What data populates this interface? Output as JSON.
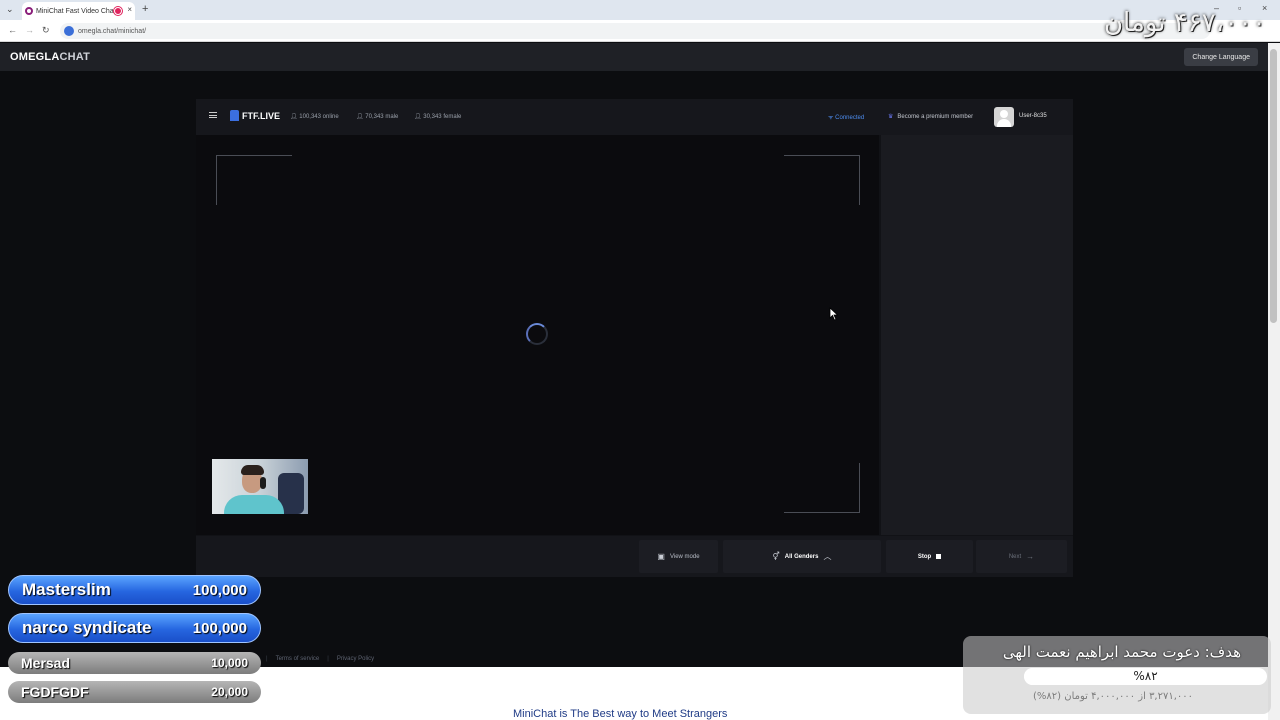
{
  "browser": {
    "tab_title": "MiniChat Fast Video Chat",
    "tab_close": "×",
    "new_tab": "+",
    "url": "omegla.chat/minichat/"
  },
  "overlay": {
    "top_amount": "۴۶۷،۰۰۰ تومان"
  },
  "site": {
    "logo_main": "OMEGLA",
    "logo_suffix": "CHAT",
    "change_language": "Change Language"
  },
  "app": {
    "brand": "FTF.LIVE",
    "online": "100,343 online",
    "male": "70,343 male",
    "female": "30,343 female",
    "connected": "Connected",
    "premium": "Become a premium member",
    "username": "User-8c35"
  },
  "controls": {
    "view_mode": "View mode",
    "all_genders": "All Genders",
    "stop": "Stop",
    "next": "Next"
  },
  "footer": {
    "terms": "Terms of service",
    "privacy": "Privacy Policy",
    "tagline": "MiniChat is The Best way to Meet Strangers"
  },
  "donations": [
    {
      "name": "Masterslim",
      "amount": "100,000"
    },
    {
      "name": "narco syndicate",
      "amount": "100,000"
    },
    {
      "name": "Mersad",
      "amount": "10,000"
    },
    {
      "name": "FGDFGDF",
      "amount": "20,000"
    }
  ],
  "goal": {
    "title": "هدف: دعوت محمد ابراهیم نعمت الهی",
    "percent_label": "%۸۲",
    "progress_fraction": 0.82,
    "subtitle": "۳,۲۷۱,۰۰۰ از ۴,۰۰۰,۰۰۰ تومان (۸۲%)"
  },
  "colors": {
    "accent_blue": "#3b6fe0",
    "donation_blue": "#2666e0",
    "connected_blue": "#4d8df0"
  }
}
